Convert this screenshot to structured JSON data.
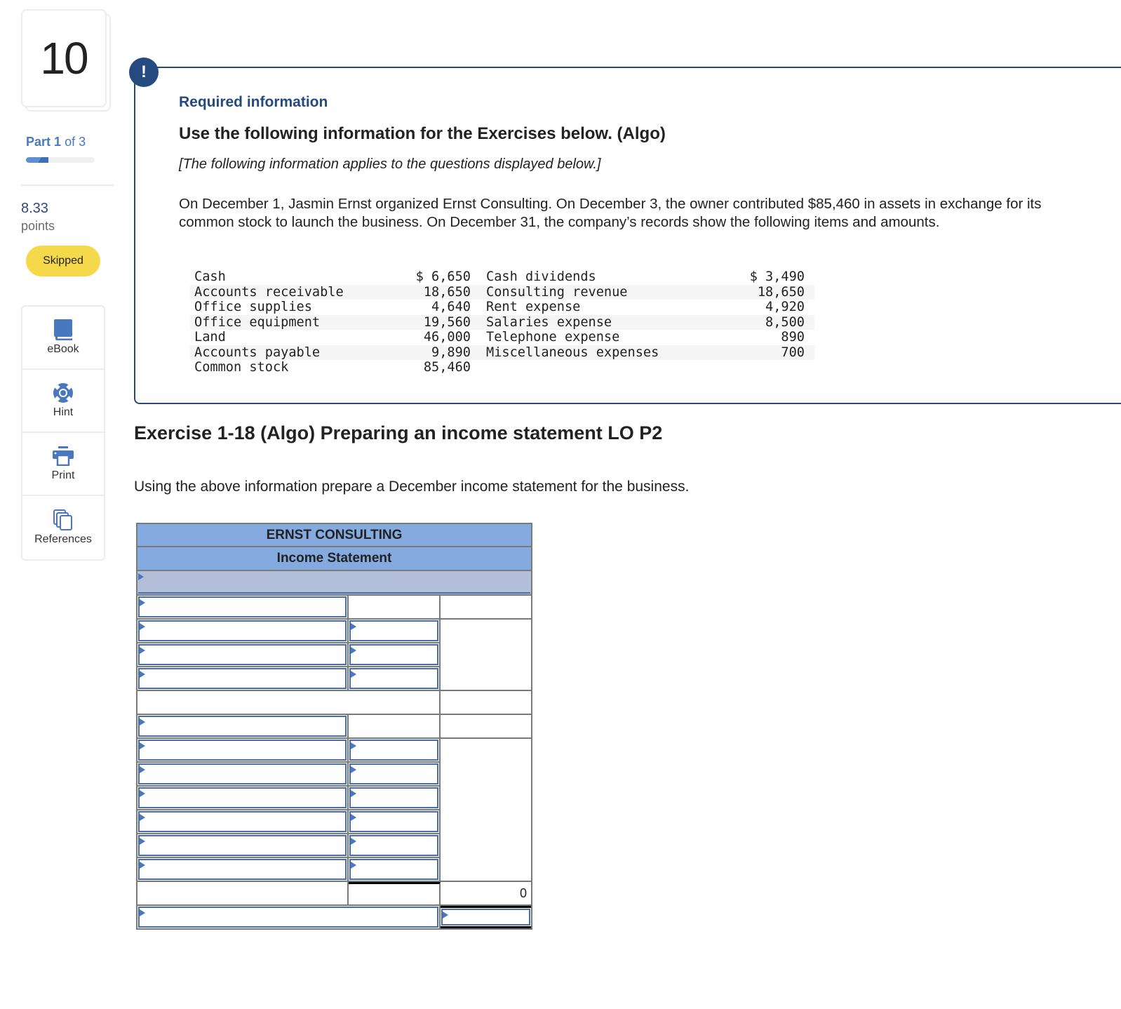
{
  "sidebar": {
    "question_number": "10",
    "part_label": "Part",
    "part_current": "1",
    "part_of": "of 3",
    "part_progress": 0.33,
    "points_value": "8.33",
    "points_label": "points",
    "status_badge": "Skipped",
    "tools": [
      {
        "label": "eBook",
        "icon": "book-icon"
      },
      {
        "label": "Hint",
        "icon": "lifebuoy-icon"
      },
      {
        "label": "Print",
        "icon": "printer-icon"
      },
      {
        "label": "References",
        "icon": "copy-pages-icon"
      }
    ]
  },
  "info_box": {
    "alert_icon_glyph": "!",
    "title": "Required information",
    "heading": "Use the following information for the Exercises below. (Algo)",
    "applies_note": "[The following information applies to the questions displayed below.]",
    "scenario": "On December 1, Jasmin Ernst organized Ernst Consulting. On December 3, the owner contributed $85,460 in assets in exchange for its common stock to launch the business. On December 31, the company’s records show the following items and amounts.",
    "ledger": [
      {
        "name1": "Cash",
        "value1": "$ 6,650",
        "name2": "Cash dividends",
        "value2": "$ 3,490"
      },
      {
        "name1": "Accounts receivable",
        "value1": "18,650",
        "name2": "Consulting revenue",
        "value2": "18,650"
      },
      {
        "name1": "Office supplies",
        "value1": "4,640",
        "name2": "Rent expense",
        "value2": "4,920"
      },
      {
        "name1": "Office equipment",
        "value1": "19,560",
        "name2": "Salaries expense",
        "value2": "8,500"
      },
      {
        "name1": "Land",
        "value1": "46,000",
        "name2": "Telephone expense",
        "value2": "890"
      },
      {
        "name1": "Accounts payable",
        "value1": "9,890",
        "name2": "Miscellaneous expenses",
        "value2": "700"
      },
      {
        "name1": "Common stock",
        "value1": "85,460",
        "name2": "",
        "value2": ""
      }
    ]
  },
  "exercise": {
    "title": "Exercise 1-18 (Algo) Preparing an income statement LO P2",
    "instruction": "Using the above information prepare a December income statement for the business."
  },
  "worksheet": {
    "company": "ERNST CONSULTING",
    "statement": "Income Statement",
    "date_value": "",
    "total_expenses_value": "0",
    "net_income_label_value": "",
    "net_income_value": ""
  }
}
